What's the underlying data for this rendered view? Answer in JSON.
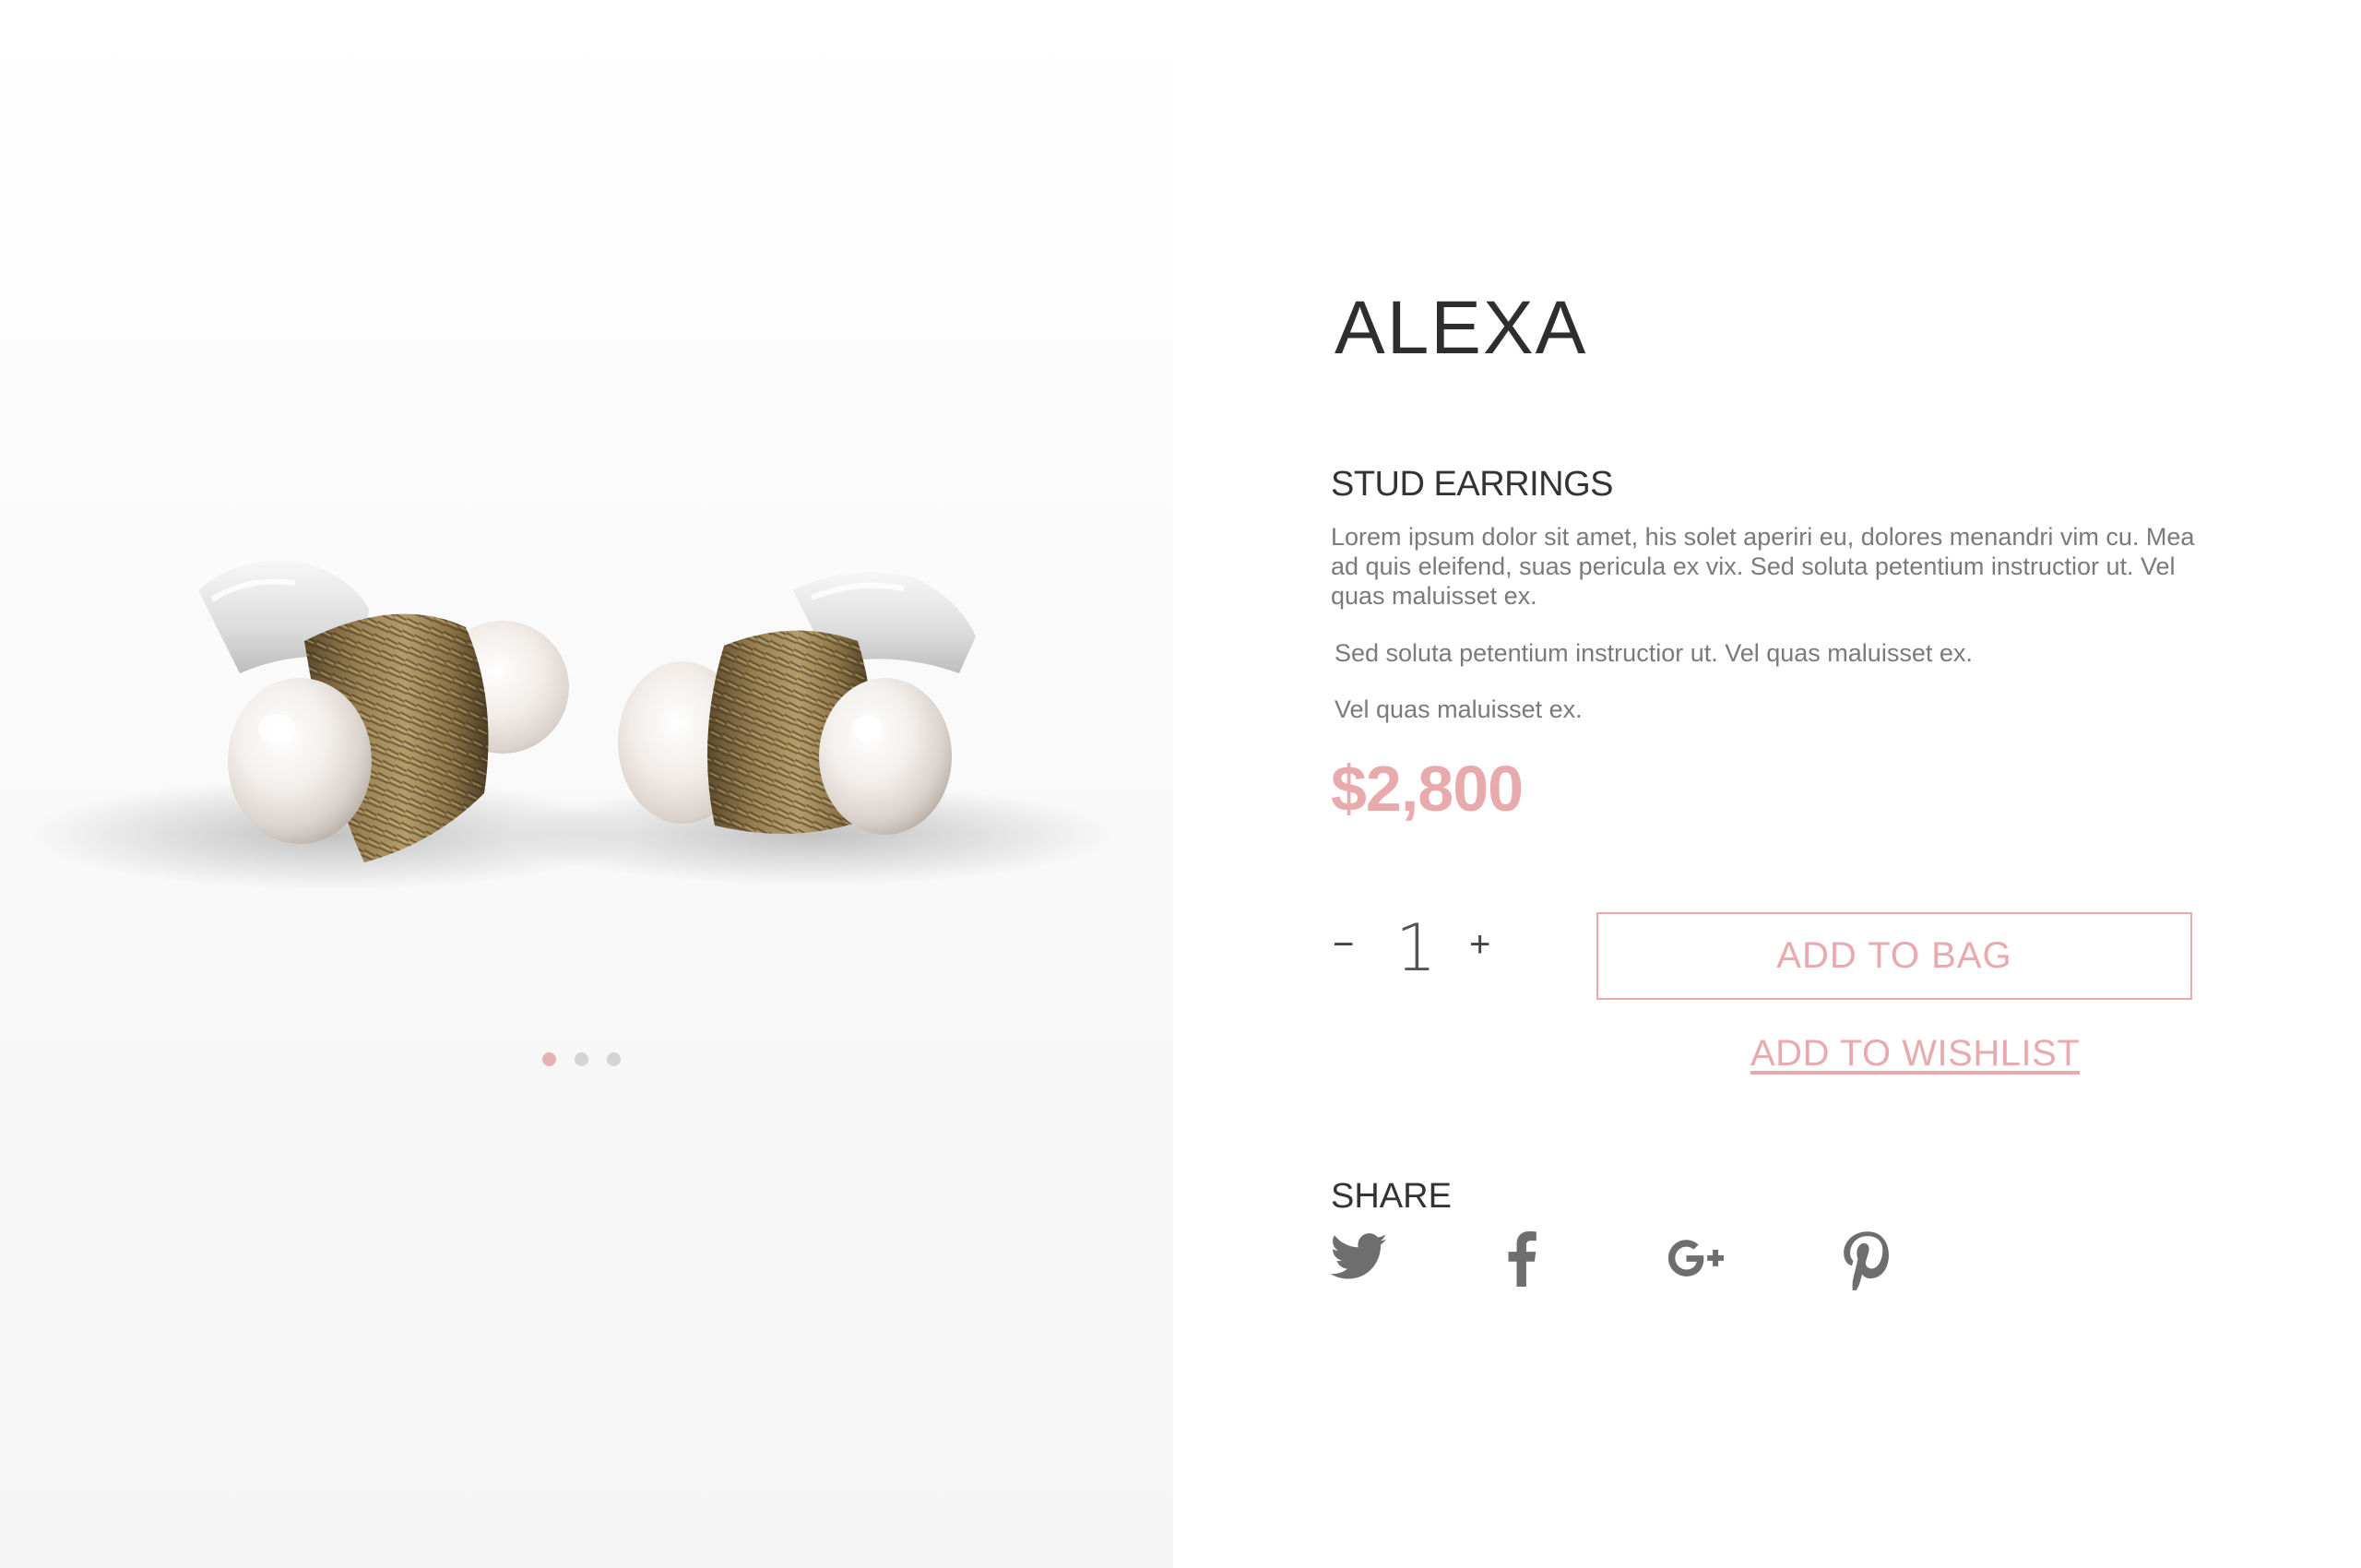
{
  "product": {
    "name": "ALEXA",
    "type": "STUD EARRINGS",
    "description": [
      "Lorem ipsum dolor sit amet, his solet aperiri eu, dolores menandri vim cu. Mea ad quis eleifend, suas pericula ex vix. Sed soluta petentium instructior ut. Vel quas maluisset ex.",
      "Sed soluta petentium instructior ut. Vel quas maluisset ex.",
      "Vel quas maluisset ex."
    ],
    "price": "$2,800"
  },
  "gallery": {
    "slide_count": 3,
    "active_slide": 1
  },
  "quantity": {
    "minus": "−",
    "value": "1",
    "plus": "+"
  },
  "actions": {
    "add_to_bag": "ADD TO BAG",
    "add_to_wishlist": "ADD TO WISHLIST"
  },
  "share": {
    "label": "SHARE",
    "icons": [
      "twitter-icon",
      "facebook-icon",
      "google-plus-icon",
      "pinterest-icon"
    ]
  },
  "colors": {
    "accent": "#e8aaac",
    "text_dark": "#2e2e2e",
    "text_muted": "#7a7a7a",
    "icon_gray": "#6e6e6e"
  }
}
